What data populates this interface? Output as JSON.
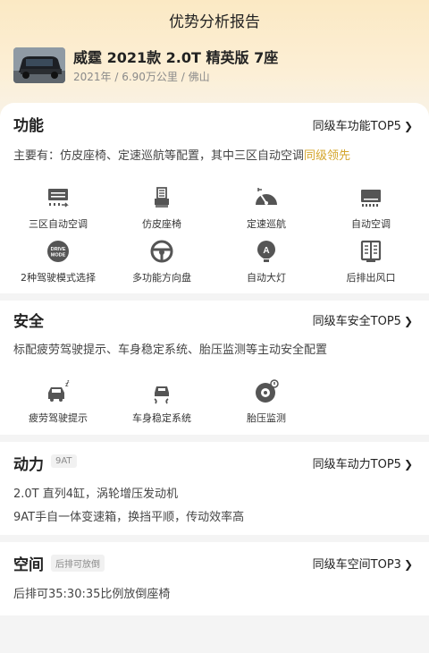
{
  "page": {
    "title": "优势分析报告"
  },
  "car": {
    "name": "威霆 2021款 2.0T 精英版 7座",
    "meta": "2021年 / 6.90万公里 / 佛山"
  },
  "sections": {
    "function": {
      "title": "功能",
      "link": "同级车功能TOP5",
      "desc_prefix": "主要有：仿皮座椅、定速巡航等配置，其中三区自动空调",
      "desc_highlight": "同级领先",
      "features": [
        {
          "label": "三区自动空调",
          "icon": "ac-vent-icon"
        },
        {
          "label": "仿皮座椅",
          "icon": "seat-icon"
        },
        {
          "label": "定速巡航",
          "icon": "speedometer-icon"
        },
        {
          "label": "自动空调",
          "icon": "auto-ac-icon"
        },
        {
          "label": "2种驾驶模式选择",
          "icon": "drive-mode-icon",
          "badge_line1": "DRIVE",
          "badge_line2": "MODE"
        },
        {
          "label": "多功能方向盘",
          "icon": "steering-wheel-icon"
        },
        {
          "label": "自动大灯",
          "icon": "headlight-icon",
          "badge": "A"
        },
        {
          "label": "后排出风口",
          "icon": "rear-vent-icon"
        }
      ]
    },
    "safety": {
      "title": "安全",
      "link": "同级车安全TOP5",
      "desc": "标配疲劳驾驶提示、车身稳定系统、胎压监测等主动安全配置",
      "features": [
        {
          "label": "疲劳驾驶提示",
          "icon": "fatigue-icon"
        },
        {
          "label": "车身稳定系统",
          "icon": "stability-icon"
        },
        {
          "label": "胎压监测",
          "icon": "tire-pressure-icon"
        }
      ]
    },
    "power": {
      "title": "动力",
      "tag": "9AT",
      "link": "同级车动力TOP5",
      "lines": [
        "2.0T 直列4缸，涡轮增压发动机",
        "9AT手自一体变速箱，换挡平顺，传动效率高"
      ]
    },
    "space": {
      "title": "空间",
      "tag": "后排可放倒",
      "link": "同级车空间TOP3",
      "desc": "后排可35:30:35比例放倒座椅"
    }
  },
  "colors": {
    "accent": "#d4a52c",
    "header_top": "#fbe9c4",
    "icon": "#555555"
  }
}
